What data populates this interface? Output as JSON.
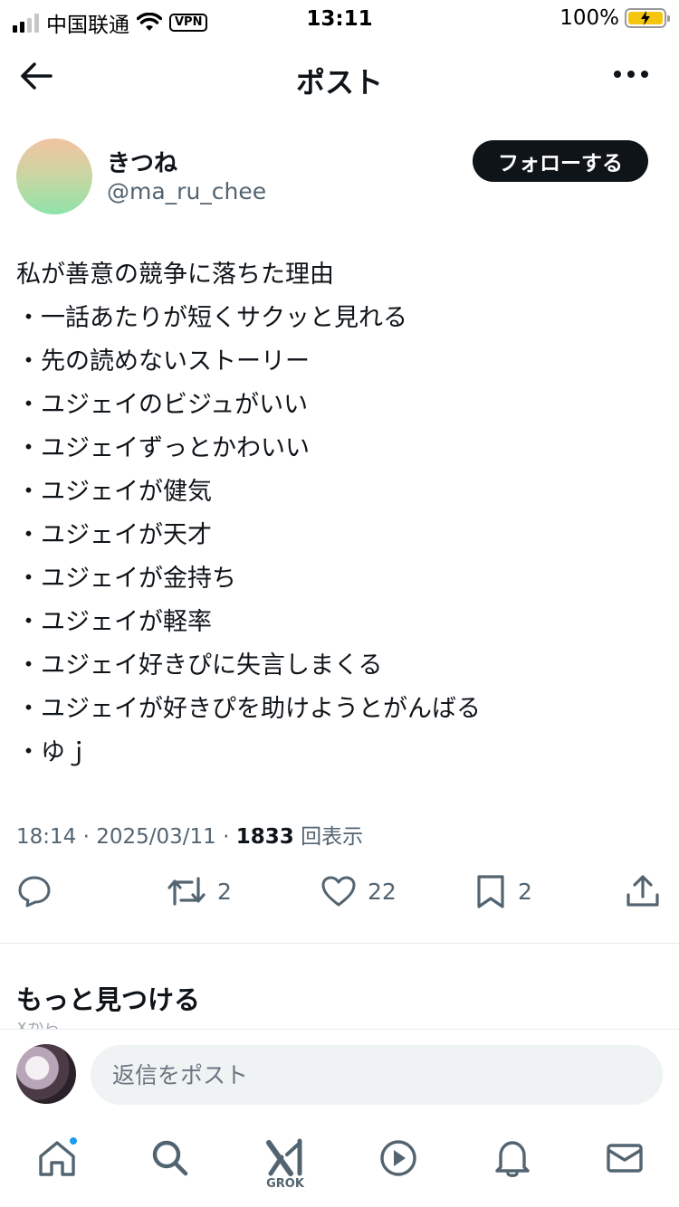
{
  "status_bar": {
    "carrier": "中国联通",
    "vpn": "VPN",
    "time": "13:11",
    "battery": "100%"
  },
  "header": {
    "title": "ポスト"
  },
  "author": {
    "name": "きつね",
    "handle": "@ma_ru_chee",
    "follow_label": "フォローする"
  },
  "post": {
    "lines": [
      "私が善意の競争に落ちた理由",
      "・一話あたりが短くサクッと見れる",
      "・先の読めないストーリー",
      "・ユジェイのビジュがいい",
      "・ユジェイずっとかわいい",
      "・ユジェイが健気",
      "・ユジェイが天才",
      "・ユジェイが金持ち",
      "・ユジェイが軽率",
      "・ユジェイ好きぴに失言しまくる",
      "・ユジェイが好きぴを助けようとがんばる",
      "・ゆｊ"
    ],
    "time": "18:14",
    "date": "2025/03/11",
    "views_count": "1833",
    "views_label": "回表示"
  },
  "actions": {
    "reply_count": "",
    "repost_count": "2",
    "like_count": "22",
    "bookmark_count": "2"
  },
  "discover": {
    "title": "もっと見つける",
    "peek": "Xから"
  },
  "reply_bar": {
    "placeholder": "返信をポスト"
  },
  "tab_bar": {
    "grok_label": "GROK"
  },
  "colors": {
    "text": "#0f1419",
    "secondary": "#536471",
    "accent_blue": "#1d9bf0",
    "follow_button": "#0f1419"
  }
}
